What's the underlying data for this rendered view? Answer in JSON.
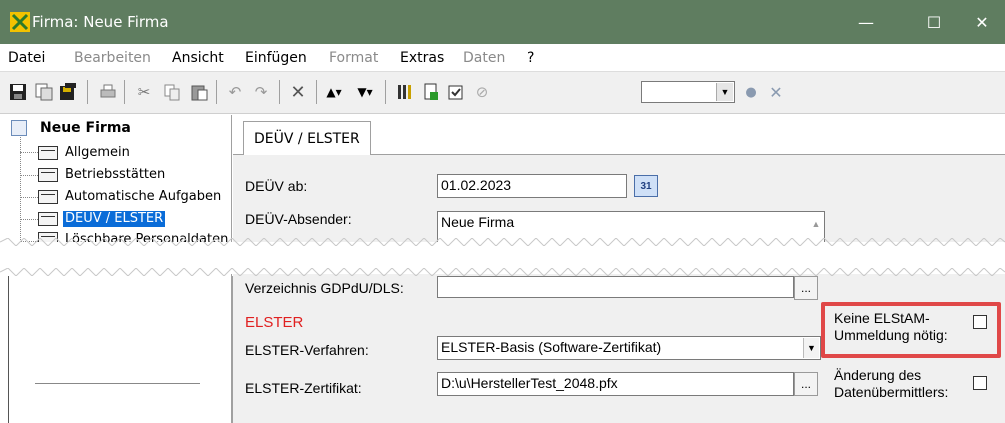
{
  "window": {
    "title": "Firma: Neue Firma",
    "minimize": "—",
    "maximize": "☐",
    "close": "✕"
  },
  "menu": [
    "Datei",
    "Bearbeiten",
    "Ansicht",
    "Einfügen",
    "Format",
    "Extras",
    "Daten",
    "?"
  ],
  "menu_disabled": [
    false,
    true,
    false,
    false,
    true,
    false,
    true,
    false
  ],
  "toolbar": {
    "icons": [
      "save-icon",
      "copy-doc-icon",
      "save-all-icon",
      "print-icon",
      "cut-icon",
      "copy-icon",
      "paste-icon",
      "undo-icon",
      "redo-icon",
      "delete-icon",
      "up-icon",
      "down-icon",
      "filter-icon",
      "import-icon",
      "check-icon",
      "settings-icon",
      "search-icon",
      "clear-icon"
    ],
    "combo_value": ""
  },
  "tree": {
    "root": "Neue Firma",
    "items": [
      "Allgemein",
      "Betriebsstätten",
      "Automatische Aufgaben",
      "DEÜV / ELSTER",
      "Löschbare Personaldaten"
    ],
    "selected_index": 3
  },
  "tab": {
    "label": "DEÜV / ELSTER"
  },
  "form": {
    "deuev_ab_label": "DEÜV ab:",
    "deuev_ab_value": "01.02.2023",
    "cal_label": "31",
    "deuev_absender_label": "DEÜV-Absender:",
    "deuev_absender_value": "Neue Firma",
    "verzeichnis_label": "Verzeichnis GDPdU/DLS:",
    "verzeichnis_value": "",
    "elster_section": "ELSTER",
    "elster_verfahren_label": "ELSTER-Verfahren:",
    "elster_verfahren_value": "ELSTER-Basis (Software-Zertifikat)",
    "elster_zertifikat_label": "ELSTER-Zertifikat:",
    "elster_zertifikat_value": "D:\\u\\HerstellerTest_2048.pfx",
    "dots": "...",
    "keine_elstam_line1": "Keine ELStAM-",
    "keine_elstam_line2": "Ummeldung nötig:",
    "keine_elstam_checked": false,
    "aenderung_line1": "Änderung des",
    "aenderung_line2": "Datenübermittlers:",
    "aenderung_checked": false
  },
  "colors": {
    "titlebar": "#5f7d60",
    "elster_section": "#e02020",
    "highlight_box": "#e04848",
    "selection": "#0a6cd8"
  }
}
